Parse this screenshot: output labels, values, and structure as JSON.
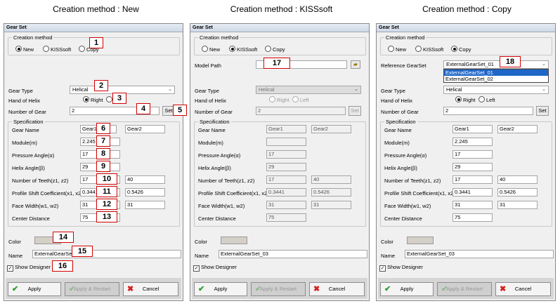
{
  "headings": [
    "Creation method : New",
    "Creation method : KISSsoft",
    "Creation method : Copy"
  ],
  "window_title": "Gear Set",
  "labels": {
    "creation_method": "Creation method",
    "gear_type": "Gear Type",
    "hand_of_helix": "Hand of Helix",
    "number_of_gear": "Number of Gear",
    "specification": "Specification",
    "gear_name": "Gear Name",
    "module": "Module(m)",
    "pressure_angle": "Pressure Angle(α)",
    "helix_angle": "Helix Angle(β)",
    "number_of_teeth": "Number of Teeth(z1, z2)",
    "profile_shift": "Profile Shift Coefficient(x1, x2)",
    "face_width": "Face Width(w1, w2)",
    "center_distance": "Center Distance",
    "color": "Color",
    "name": "Name",
    "show_designer": "Show Designer",
    "model_path": "Model Path",
    "reference_gearset": "Reference GearSet"
  },
  "options": {
    "new": "New",
    "kisssoft": "KISSsoft",
    "copy": "Copy",
    "right": "Right",
    "left": "Left"
  },
  "buttons": {
    "set": "Set",
    "apply": "Apply",
    "apply_restart": "Apply & Restart",
    "cancel": "Cancel"
  },
  "values": {
    "gear_type": "Helical",
    "number_of_gear": "2",
    "gear1": "Gear1",
    "gear2": "Gear2",
    "module": "2.245",
    "pressure_angle": "17",
    "helix_angle": "29",
    "z1": "17",
    "z2": "40",
    "x1": "0.3441",
    "x2": "0.5426",
    "w1": "31",
    "w2": "31",
    "center_distance": "75",
    "name_new": "ExternalGearSet_",
    "name_03": "ExternalGearSet_03",
    "ref_selected": "ExternalGearSet_01",
    "ref_options": [
      "ExternalGearSet_01",
      "ExternalGearSet_02"
    ]
  },
  "badges": [
    "1",
    "2",
    "3",
    "4",
    "5",
    "6",
    "7",
    "8",
    "9",
    "10",
    "11",
    "12",
    "13",
    "14",
    "15",
    "16",
    "17",
    "18"
  ],
  "colors": {
    "badge_border": "#d10000",
    "selection": "#1e66c8",
    "color_swatch": "#d4d0c8"
  }
}
